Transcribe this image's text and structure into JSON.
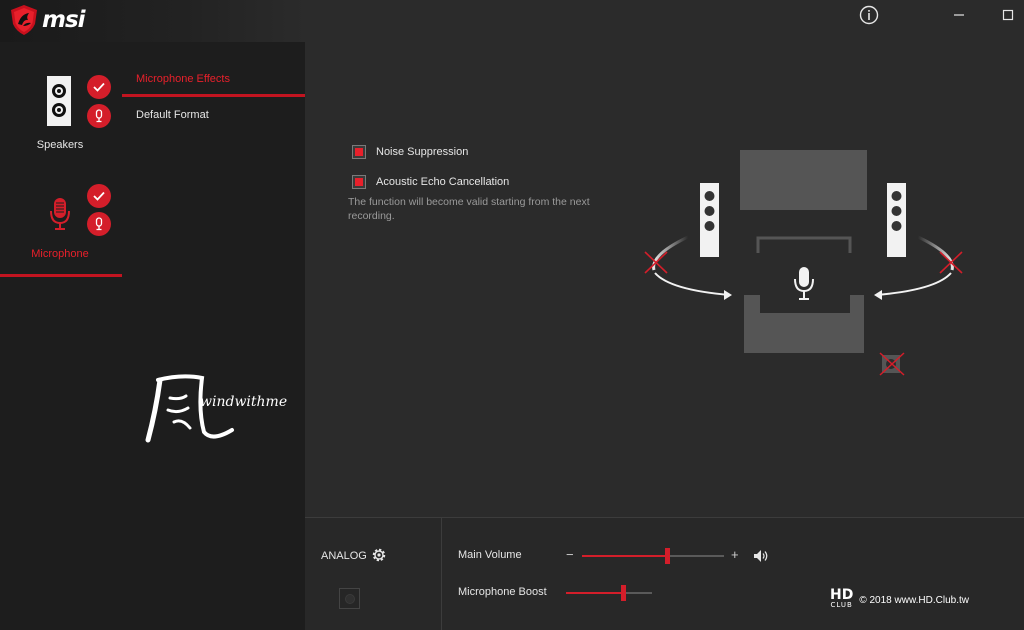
{
  "brand": {
    "name": "msi"
  },
  "devices": [
    {
      "label": "Speakers",
      "active": false
    },
    {
      "label": "Microphone",
      "active": true
    }
  ],
  "menu": {
    "items": [
      {
        "label": "Microphone Effects",
        "active": true
      },
      {
        "label": "Default Format",
        "active": false
      }
    ]
  },
  "window_controls": {
    "info": "info-icon",
    "minimize": "minimize-icon",
    "maximize": "maximize-icon"
  },
  "effects": {
    "options": [
      {
        "label": "Noise Suppression",
        "checked": true
      },
      {
        "label": "Acoustic Echo Cancellation",
        "checked": true
      }
    ],
    "note": "The function will become valid starting from the next recording."
  },
  "bottom": {
    "connector": "ANALOG",
    "main_volume": {
      "label": "Main Volume",
      "minus": "−",
      "plus": "+",
      "level": 0.6
    },
    "mic_boost": {
      "label": "Microphone Boost",
      "level": 0.66
    }
  },
  "watermark": {
    "text": "windwithme"
  },
  "credit": {
    "logo_top": "HD",
    "logo_bottom": "CLUB",
    "text": "© 2018 www.HD.Club.tw"
  },
  "colors": {
    "accent": "#d41e2a",
    "background": "#2b2b2b",
    "sidebar": "#1d1d1d"
  }
}
